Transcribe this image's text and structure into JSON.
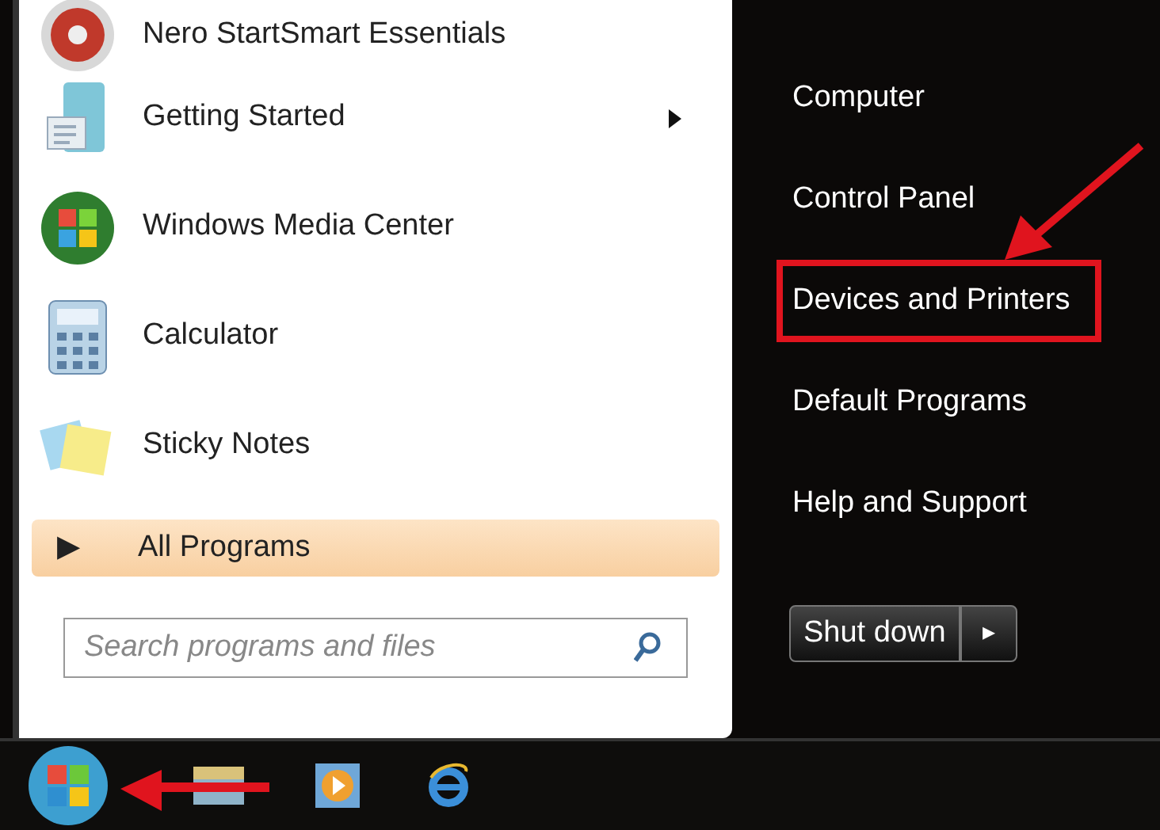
{
  "programs": [
    {
      "label": "Nero StartSmart Essentials",
      "submenu": false
    },
    {
      "label": "Getting Started",
      "submenu": true
    },
    {
      "label": "Windows Media Center",
      "submenu": false
    },
    {
      "label": "Calculator",
      "submenu": false
    },
    {
      "label": "Sticky Notes",
      "submenu": false
    }
  ],
  "all_programs": {
    "arrow": "▶",
    "label": "All Programs"
  },
  "search": {
    "placeholder": "Search programs and files"
  },
  "places": [
    {
      "label": "Computer",
      "highlighted": false
    },
    {
      "label": "Control Panel",
      "highlighted": false
    },
    {
      "label": "Devices and Printers",
      "highlighted": true
    },
    {
      "label": "Default Programs",
      "highlighted": false
    },
    {
      "label": "Help and Support",
      "highlighted": false
    }
  ],
  "shutdown": {
    "label": "Shut down",
    "arrow": "▸"
  }
}
